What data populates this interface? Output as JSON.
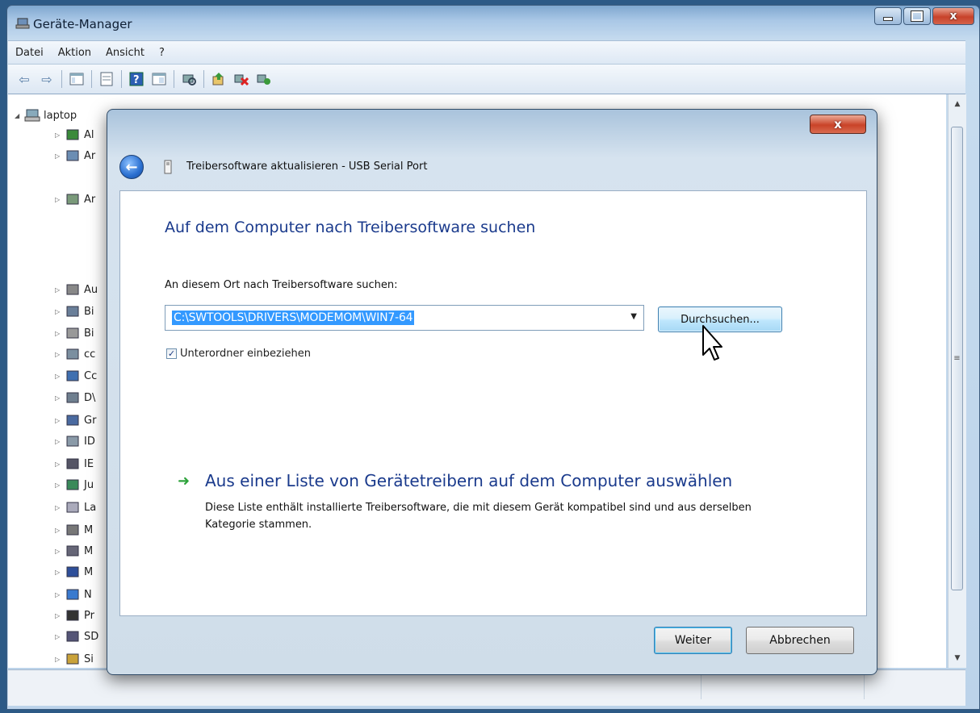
{
  "main_window": {
    "title": "Geräte-Manager",
    "menu": [
      "Datei",
      "Aktion",
      "Ansicht",
      "?"
    ],
    "tree_root": "laptop",
    "tree_items": [
      "Al",
      "Ar",
      "Ar",
      "Au",
      "Bi",
      "Bi",
      "cc",
      "Cc",
      "D\\",
      "Gr",
      "ID",
      "IE",
      "Ju",
      "La",
      "M",
      "M",
      "M",
      "N",
      "Pr",
      "SD",
      "Si"
    ]
  },
  "dialog": {
    "close_label": "x",
    "title": "Treibersoftware aktualisieren - USB Serial Port",
    "heading": "Auf dem Computer nach Treibersoftware suchen",
    "search_label": "An diesem Ort nach Treibersoftware suchen:",
    "path_value": "C:\\SWTOOLS\\DRIVERS\\MODEMOM\\WIN7-64",
    "browse_label": "Durchsuchen...",
    "include_subfolders_label": "Unterordner einbeziehen",
    "include_subfolders_checked": true,
    "option_title": "Aus einer Liste von Gerätetreibern auf dem Computer auswählen",
    "option_desc": "Diese Liste enthält installierte Treibersoftware, die mit diesem Gerät kompatibel sind und aus derselben Kategorie stammen.",
    "next_label": "Weiter",
    "cancel_label": "Abbrechen"
  },
  "colors": {
    "heading_blue": "#1a3a8c",
    "selection": "#3399ff",
    "arrow_green": "#2fa33c"
  }
}
